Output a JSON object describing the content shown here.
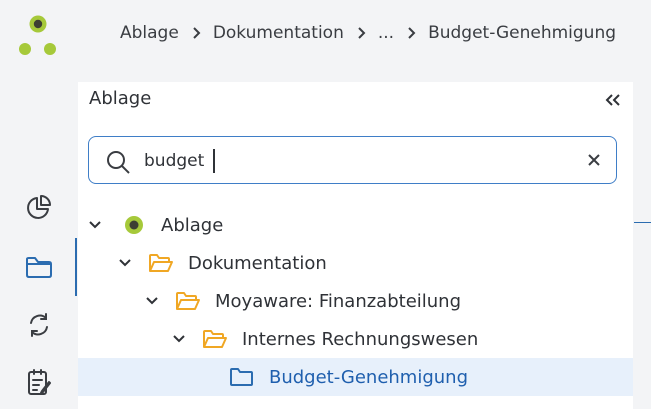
{
  "breadcrumb": {
    "items": [
      "Ablage",
      "Dokumentation",
      "...",
      "Budget-Genehmigung"
    ]
  },
  "sidebar": {
    "items": [
      {
        "icon": "pie-chart-icon",
        "active": false
      },
      {
        "icon": "folder-icon",
        "active": true
      },
      {
        "icon": "sync-icon",
        "active": false
      },
      {
        "icon": "checklist-edit-icon",
        "active": false
      }
    ]
  },
  "panel": {
    "title": "Ablage",
    "collapse_icon": "double-chevron-left-icon"
  },
  "search": {
    "value": "budget",
    "icon": "search-icon",
    "clear_icon": "close-icon"
  },
  "tree": {
    "nodes": [
      {
        "label": "Ablage",
        "depth": 0,
        "expanded": true,
        "icon": "root-dot-icon",
        "selected": false
      },
      {
        "label": "Dokumentation",
        "depth": 1,
        "expanded": true,
        "icon": "folder-open-icon",
        "selected": false
      },
      {
        "label": "Moyaware: Finanzabteilung",
        "depth": 2,
        "expanded": true,
        "icon": "folder-open-icon",
        "selected": false
      },
      {
        "label": "Internes Rechnungswesen",
        "depth": 3,
        "expanded": true,
        "icon": "folder-open-icon",
        "selected": false
      },
      {
        "label": "Budget-Genehmigung",
        "depth": 4,
        "expanded": false,
        "icon": "folder-icon",
        "selected": true
      }
    ]
  },
  "colors": {
    "accent": "#2b6cb0",
    "folder": "#f0a724",
    "logo_green": "#a6c93a",
    "selected_bg": "#e7f0fb"
  }
}
